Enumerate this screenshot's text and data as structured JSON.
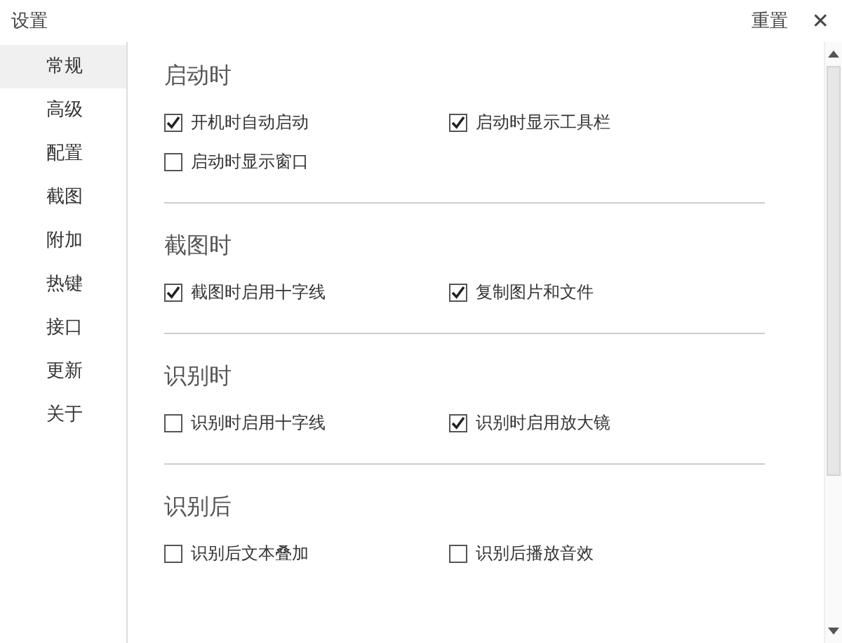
{
  "window": {
    "title": "设置",
    "reset": "重置",
    "close": "✕"
  },
  "sidebar": {
    "items": [
      {
        "label": "常规",
        "selected": true
      },
      {
        "label": "高级",
        "selected": false
      },
      {
        "label": "配置",
        "selected": false
      },
      {
        "label": "截图",
        "selected": false
      },
      {
        "label": "附加",
        "selected": false
      },
      {
        "label": "热键",
        "selected": false
      },
      {
        "label": "接口",
        "selected": false
      },
      {
        "label": "更新",
        "selected": false
      },
      {
        "label": "关于",
        "selected": false
      }
    ]
  },
  "sections": [
    {
      "title": "启动时",
      "options": [
        {
          "label": "开机时自动启动",
          "checked": true
        },
        {
          "label": "启动时显示工具栏",
          "checked": true
        },
        {
          "label": "启动时显示窗口",
          "checked": false
        }
      ]
    },
    {
      "title": "截图时",
      "options": [
        {
          "label": "截图时启用十字线",
          "checked": true
        },
        {
          "label": "复制图片和文件",
          "checked": true
        }
      ]
    },
    {
      "title": "识别时",
      "options": [
        {
          "label": "识别时启用十字线",
          "checked": false
        },
        {
          "label": "识别时启用放大镜",
          "checked": true
        }
      ]
    },
    {
      "title": "识别后",
      "options": [
        {
          "label": "识别后文本叠加",
          "checked": false
        },
        {
          "label": "识别后播放音效",
          "checked": false
        }
      ]
    }
  ]
}
